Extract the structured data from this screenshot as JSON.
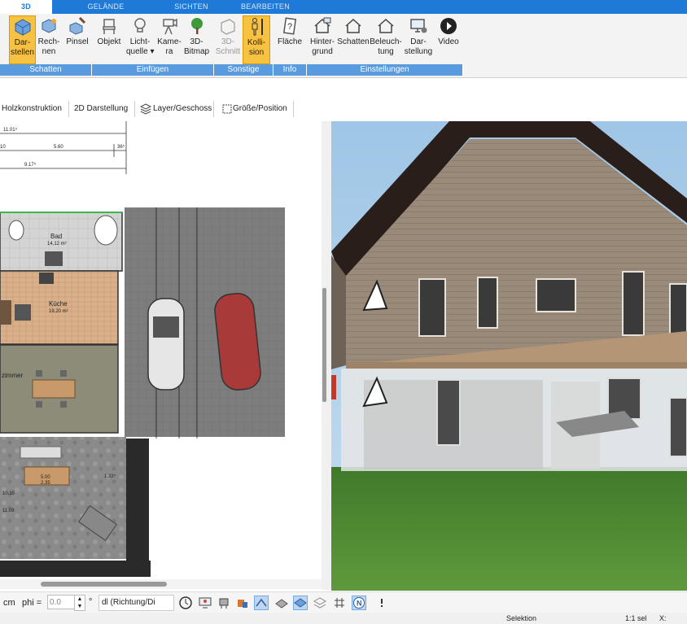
{
  "tabs": [
    {
      "label": "3D",
      "active": true
    },
    {
      "label": "GELÄNDE",
      "active": false
    },
    {
      "label": "SICHTEN",
      "active": false
    },
    {
      "label": "BEARBEITEN",
      "active": false
    }
  ],
  "ribbon": {
    "buttons": [
      {
        "label": "Dar-\nstellen",
        "icon": "cube-icon",
        "active": true
      },
      {
        "label": "Rech-\nnen",
        "icon": "render-cube-icon"
      },
      {
        "label": "Pinsel",
        "icon": "paint-cube-icon"
      },
      {
        "label": "Objekt",
        "icon": "chair-icon"
      },
      {
        "label": "Licht-\nquelle ▾",
        "icon": "lightbulb-icon"
      },
      {
        "label": "Kame-\nra",
        "icon": "camera-icon"
      },
      {
        "label": "3D-\nBitmap",
        "icon": "tree-icon"
      },
      {
        "label": "3D-\nSchnitt",
        "icon": "section-icon",
        "disabled": true
      },
      {
        "label": "Kolli-\nsion",
        "icon": "person-icon",
        "active": true
      },
      {
        "label": "Fläche",
        "icon": "area-info-icon"
      },
      {
        "label": "Hinter-\ngrund",
        "icon": "house-background-icon"
      },
      {
        "label": "Schatten",
        "icon": "house-shadow-icon"
      },
      {
        "label": "Beleuch-\ntung",
        "icon": "house-light-icon"
      },
      {
        "label": "Dar-\nstellung",
        "icon": "monitor-settings-icon"
      },
      {
        "label": "Video",
        "icon": "play-icon"
      }
    ],
    "groups": [
      "Schatten",
      "Einfügen",
      "Sonstige",
      "Info",
      "Einstellungen"
    ]
  },
  "toolbar": {
    "items": [
      "Holzkonstruktion",
      "2D Darstellung",
      "Layer/Geschoss",
      "Größe/Position"
    ]
  },
  "plan": {
    "dims": [
      "11.01⁵",
      "5.60",
      "9.17⁵",
      "36⁵",
      "10"
    ],
    "rooms": [
      {
        "name": "Bad",
        "area": "14,12 m²"
      },
      {
        "name": "Küche",
        "area": "19,20 m²"
      },
      {
        "name": "zimmer",
        "area": ""
      }
    ],
    "misc": [
      "5.00",
      "2.35",
      "10.35",
      "11.08",
      "1.32⁵"
    ]
  },
  "bottombar": {
    "unit": "cm",
    "phi_label": "phi =",
    "phi_value": "0.0",
    "degree": "°",
    "direction": "dl (Richtung/Di"
  },
  "status": {
    "mode": "Selektion",
    "scale": "1:1 sel",
    "x_label": "X:"
  },
  "colors": {
    "accent": "#1e7ad6",
    "ribbon_group": "#5a9be0",
    "active_button": "#f7c242",
    "grass": "#4f8a34",
    "sky": "#a9cde8"
  }
}
